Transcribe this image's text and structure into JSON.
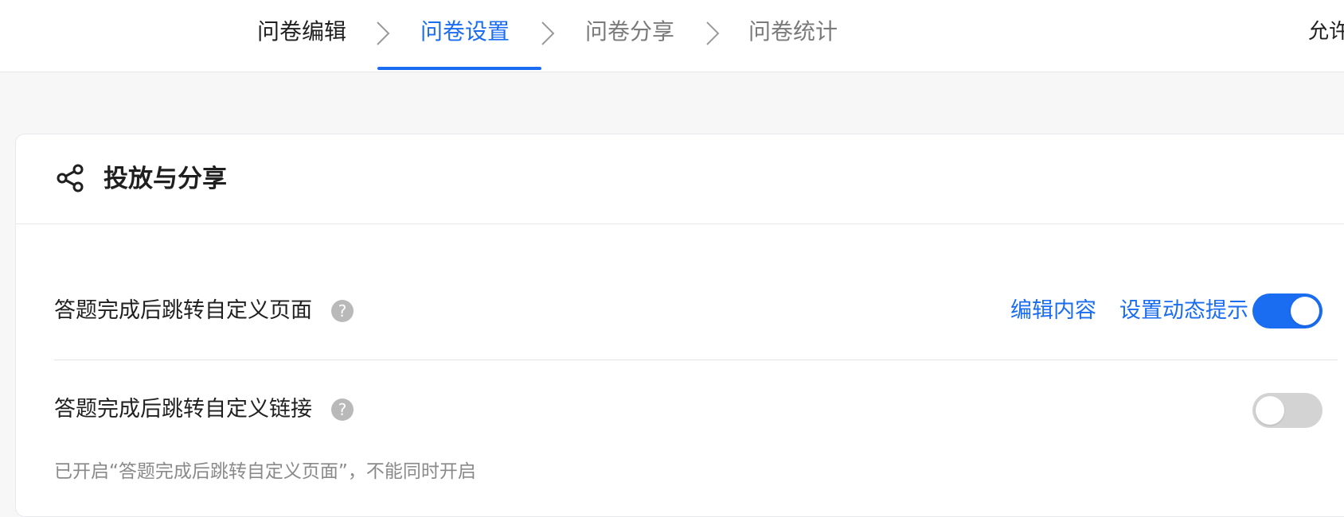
{
  "steps": [
    {
      "label": "问卷编辑",
      "state": "done"
    },
    {
      "label": "问卷设置",
      "state": "active"
    },
    {
      "label": "问卷分享",
      "state": "todo"
    },
    {
      "label": "问卷统计",
      "state": "todo"
    }
  ],
  "topbar_right_text": "允许",
  "card": {
    "icon": "share-icon",
    "title": "投放与分享",
    "rows": [
      {
        "label": "答题完成后跳转自定义页面",
        "help": "?",
        "actions": [
          "编辑内容",
          "设置动态提示"
        ],
        "toggle_on": true
      },
      {
        "label": "答题完成后跳转自定义链接",
        "help": "?",
        "toggle_on": false,
        "hint": "已开启“答题完成后跳转自定义页面”，不能同时开启"
      }
    ]
  },
  "colors": {
    "accent": "#1a6cf0",
    "toggle_off": "#d3d3d3",
    "page_bg": "#f7f7f8"
  }
}
